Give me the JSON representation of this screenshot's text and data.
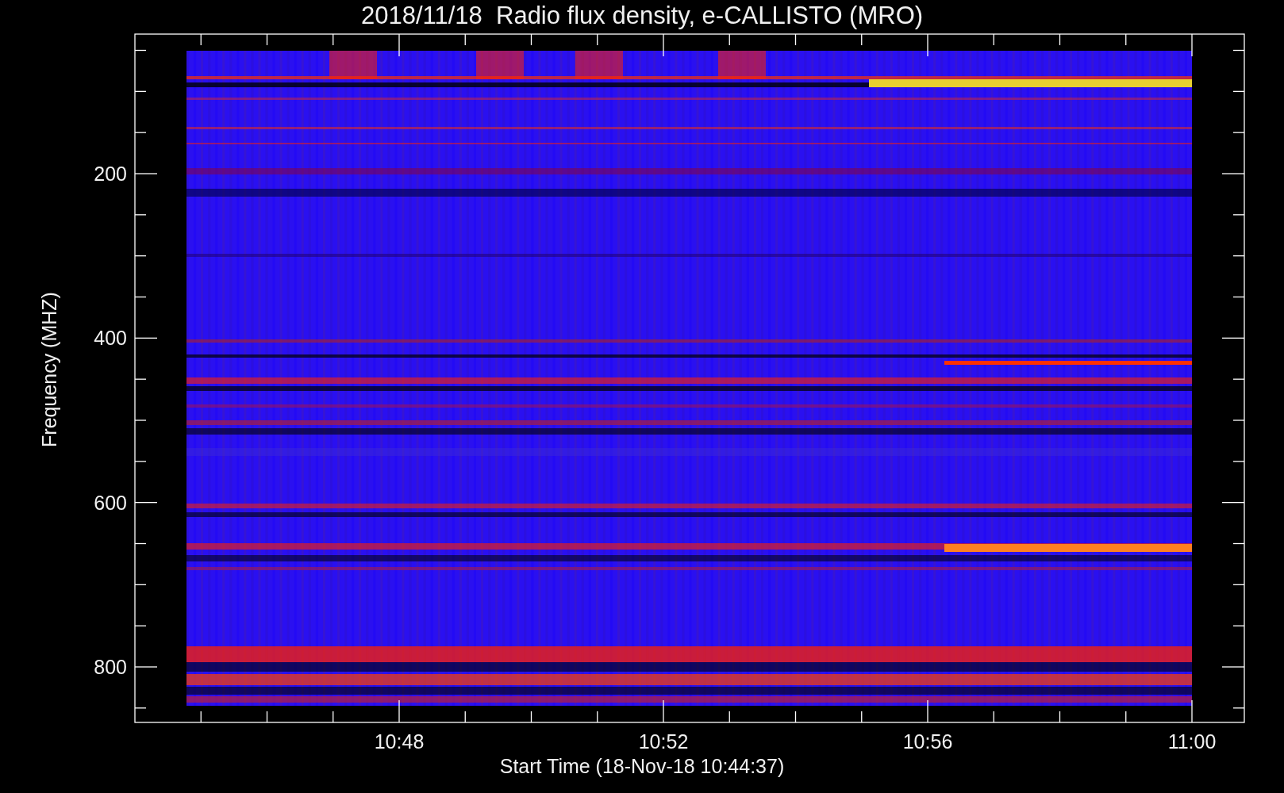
{
  "title": "2018/11/18  Radio flux density, e-CALLISTO (MRO)",
  "y_axis": {
    "label": "Frequency (MHZ)",
    "ticks": [
      "200",
      "400",
      "600",
      "800"
    ]
  },
  "x_axis": {
    "label": "Start Time (18-Nov-18 10:44:37)",
    "ticks": [
      "10:48",
      "10:52",
      "10:56",
      "11:00"
    ]
  }
}
